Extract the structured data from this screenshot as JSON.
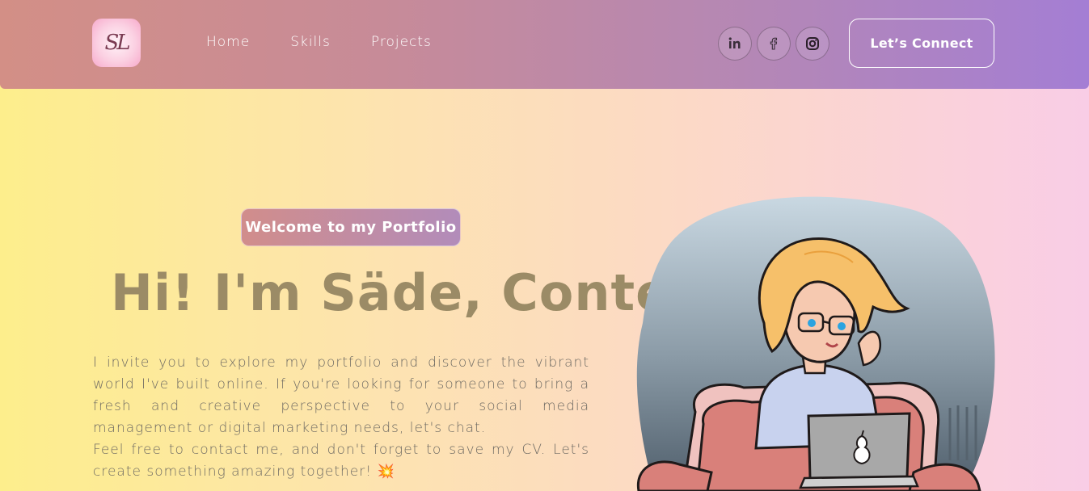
{
  "nav": {
    "logo_text": "SL",
    "links": [
      "Home",
      "Skills",
      "Projects"
    ],
    "social": [
      {
        "icon": "linkedin-icon"
      },
      {
        "icon": "facebook-icon"
      },
      {
        "icon": "instagram-icon"
      }
    ],
    "connect_label": "Let’s Connect"
  },
  "hero": {
    "badge": "Welcome to my Portfolio",
    "headline": "Hi! I'm Säde, Conte",
    "paragraph_1": "I invite you to explore my portfolio and discover the vibrant world I've built online. If you're looking for someone to bring a fresh and creative perspective to your social media management or digital marketing needs, let's chat.",
    "paragraph_2": "Feel free to contact me, and don't forget to save my CV. Let's create something amazing together!",
    "sparkle": "💥"
  },
  "colors": {
    "nav_gradient_start": "#d38f86",
    "nav_gradient_end": "#a47ed4",
    "headline": "#9b8b66",
    "body_text": "#6e6a63"
  }
}
